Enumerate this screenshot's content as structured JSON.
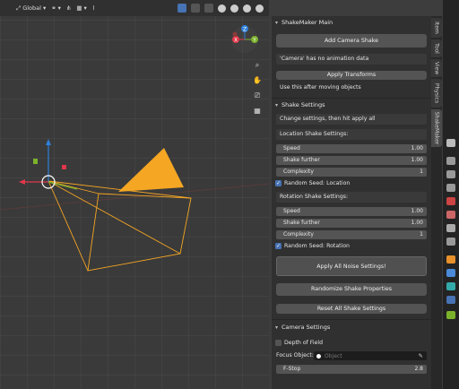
{
  "header": {
    "transform_orientation": "Global"
  },
  "tabs": [
    {
      "label": "Item"
    },
    {
      "label": "Tool"
    },
    {
      "label": "View"
    },
    {
      "label": "Physics"
    },
    {
      "label": "ShakeMaker"
    }
  ],
  "shakemaker_main": {
    "title": "ShakeMaker Main",
    "add_camera_shake": "Add Camera Shake",
    "status": "'Camera' has no animation data",
    "apply_transforms": "Apply Transforms",
    "hint": "Use this after moving objects"
  },
  "shake_settings": {
    "title": "Shake Settings",
    "info": "Change settings, then hit apply all",
    "location_title": "Location Shake Settings:",
    "location": [
      {
        "label": "Speed",
        "value": "1.00"
      },
      {
        "label": "Shake further",
        "value": "1.00"
      },
      {
        "label": "Complexity",
        "value": "1"
      }
    ],
    "random_seed_location": "Random Seed: Location",
    "rotation_title": "Rotation Shake Settings:",
    "rotation": [
      {
        "label": "Speed",
        "value": "1.00"
      },
      {
        "label": "Shake further",
        "value": "1.00"
      },
      {
        "label": "Complexity",
        "value": "1"
      }
    ],
    "random_seed_rotation": "Random Seed: Rotation",
    "apply_all": "Apply All Noise Settings!",
    "randomize": "Randomize Shake Properties",
    "reset": "Reset All Shake Settings"
  },
  "camera_settings": {
    "title": "Camera Settings",
    "depth_of_field": "Depth of Field",
    "focus_label": "Focus Object:",
    "focus_placeholder": "Object",
    "fstop_label": "F-Stop",
    "fstop_value": "2.8"
  },
  "gizmo": {
    "x": "X",
    "y": "Y",
    "z": "Z"
  },
  "colors": {
    "accent": "#4772b3",
    "camera_orange": "#f5a623",
    "axis_x": "#e0374a",
    "axis_y": "#7bb22b",
    "axis_z": "#2f7fd8"
  }
}
